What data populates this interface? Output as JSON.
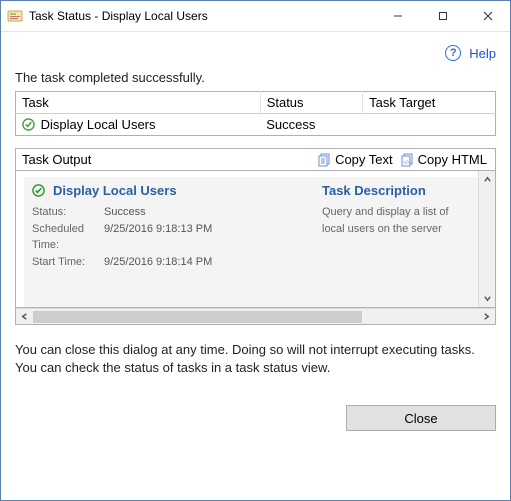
{
  "window": {
    "title": "Task Status - Display Local Users"
  },
  "help": {
    "label": "Help"
  },
  "message": "The task completed successfully.",
  "table": {
    "headers": {
      "task": "Task",
      "status": "Status",
      "target": "Task Target"
    },
    "row": {
      "task": "Display Local Users",
      "status": "Success",
      "target": ""
    }
  },
  "output": {
    "label": "Task Output",
    "copy_text": "Copy Text",
    "copy_html": "Copy HTML",
    "card": {
      "title": "Display Local Users",
      "status_label": "Status:",
      "status_value": "Success",
      "sched_label": "Scheduled Time:",
      "sched_value": "9/25/2016 9:18:13 PM",
      "start_label": "Start Time:",
      "start_value": "9/25/2016 9:18:14 PM",
      "desc_title": "Task Description",
      "desc_text": "Query and display a list of local users on the server"
    }
  },
  "note": "You can close this dialog at any time. Doing so will not interrupt executing tasks. You can check the status of tasks in a task status view.",
  "close": "Close"
}
